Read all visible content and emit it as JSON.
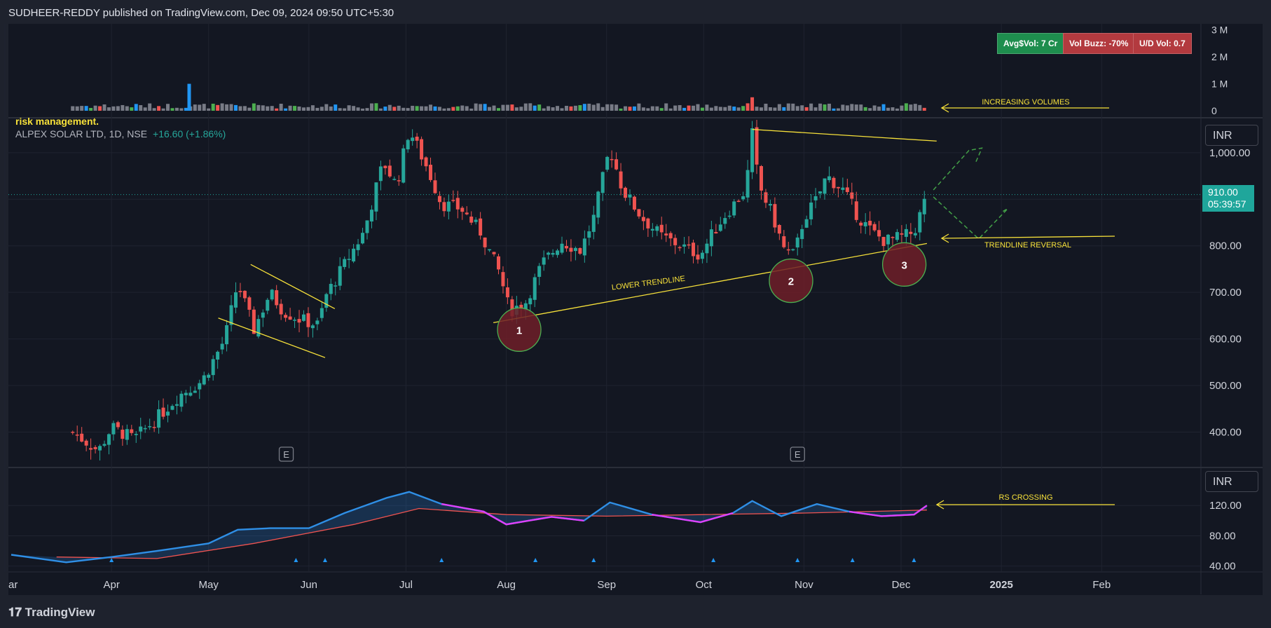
{
  "header": {
    "attribution": "SUDHEER-REDDY published on TradingView.com, Dec 09, 2024 09:50 UTC+5:30"
  },
  "footer": {
    "logo_text": "TradingView",
    "logo_icon": "tradingview-logo-icon"
  },
  "legend": {
    "note": "risk management.",
    "symbol": "ALPEX SOLAR LTD, 1D, NSE",
    "change": "+16.60 (+1.86%)"
  },
  "badges": [
    {
      "label": "Avg$Vol: 7 Cr",
      "color": "#1e8e4e"
    },
    {
      "label": "Vol Buzz: -70%",
      "color": "#b33a3f"
    },
    {
      "label": "U/D Vol: 0.7",
      "color": "#b33a3f"
    }
  ],
  "currency": {
    "main": "INR",
    "rs": "INR"
  },
  "last_price": {
    "value": "910.00",
    "countdown": "05:39:57"
  },
  "colors": {
    "up": "#26a69a",
    "down": "#ef5350",
    "annotation": "#f7e13a",
    "rs_line": "#2f8fe6",
    "rs_below": "#e040fb",
    "rs_ma": "#ef5350",
    "vol_blue": "#2196f3",
    "vol_green": "#4caf50",
    "vol_grey": "#787b86"
  },
  "chart_data": {
    "type": "candlestick",
    "symbol": "ALPEX SOLAR LTD",
    "interval": "1D",
    "exchange": "NSE",
    "x_ticks": [
      "ar",
      "Apr",
      "May",
      "Jun",
      "Jul",
      "Aug",
      "Sep",
      "Oct",
      "Nov",
      "Dec",
      "2025",
      "Feb"
    ],
    "price_axis": {
      "ylim": [
        330,
        1060
      ],
      "ticks": [
        "1,000.00",
        "900.00",
        "800.00",
        "700.00",
        "600.00",
        "500.00",
        "400.00"
      ],
      "scale": "linear"
    },
    "volume_axis": {
      "ylim": [
        0,
        3.2
      ],
      "unit": "M",
      "ticks": [
        "3 M",
        "2 M",
        "1 M",
        "0"
      ]
    },
    "rs_axis": {
      "ylim": [
        36,
        160
      ],
      "ticks": [
        "120.00",
        "80.00",
        "40.00"
      ]
    },
    "price_path": [
      [
        "2024-03-20",
        400
      ],
      [
        "2024-03-28",
        360
      ],
      [
        "2024-04-01",
        410
      ],
      [
        "2024-04-08",
        385
      ],
      [
        "2024-04-15",
        430
      ],
      [
        "2024-04-22",
        480
      ],
      [
        "2024-04-29",
        510
      ],
      [
        "2024-05-06",
        600
      ],
      [
        "2024-05-10",
        720
      ],
      [
        "2024-05-15",
        620
      ],
      [
        "2024-05-20",
        700
      ],
      [
        "2024-05-24",
        660
      ],
      [
        "2024-05-30",
        640
      ],
      [
        "2024-06-04",
        630
      ],
      [
        "2024-06-06",
        690
      ],
      [
        "2024-06-12",
        760
      ],
      [
        "2024-06-18",
        830
      ],
      [
        "2024-06-24",
        980
      ],
      [
        "2024-06-28",
        930
      ],
      [
        "2024-07-02",
        1050
      ],
      [
        "2024-07-08",
        960
      ],
      [
        "2024-07-12",
        890
      ],
      [
        "2024-07-18",
        880
      ],
      [
        "2024-07-24",
        830
      ],
      [
        "2024-07-30",
        740
      ],
      [
        "2024-08-02",
        660
      ],
      [
        "2024-08-07",
        680
      ],
      [
        "2024-08-12",
        760
      ],
      [
        "2024-08-18",
        810
      ],
      [
        "2024-08-24",
        790
      ],
      [
        "2024-08-28",
        860
      ],
      [
        "2024-09-02",
        1010
      ],
      [
        "2024-09-06",
        920
      ],
      [
        "2024-09-12",
        860
      ],
      [
        "2024-09-18",
        820
      ],
      [
        "2024-09-24",
        800
      ],
      [
        "2024-09-30",
        780
      ],
      [
        "2024-10-04",
        830
      ],
      [
        "2024-10-08",
        870
      ],
      [
        "2024-10-14",
        920
      ],
      [
        "2024-10-16",
        1040
      ],
      [
        "2024-10-18",
        930
      ],
      [
        "2024-10-22",
        870
      ],
      [
        "2024-10-26",
        790
      ],
      [
        "2024-10-29",
        780
      ],
      [
        "2024-11-01",
        860
      ],
      [
        "2024-11-05",
        900
      ],
      [
        "2024-11-08",
        950
      ],
      [
        "2024-11-13",
        920
      ],
      [
        "2024-11-18",
        860
      ],
      [
        "2024-11-22",
        830
      ],
      [
        "2024-11-26",
        810
      ],
      [
        "2024-12-02",
        820
      ],
      [
        "2024-12-05",
        830
      ],
      [
        "2024-12-09",
        910
      ]
    ],
    "volume_spikes_M": [
      {
        "date": "2024-04-25",
        "value": 1.0
      },
      {
        "date": "2024-10-16",
        "value": 0.5
      }
    ],
    "rs_series": {
      "name": "RS",
      "points": [
        [
          "2024-03-01",
          55
        ],
        [
          "2024-03-18",
          45
        ],
        [
          "2024-04-01",
          52
        ],
        [
          "2024-04-15",
          60
        ],
        [
          "2024-05-01",
          70
        ],
        [
          "2024-05-10",
          88
        ],
        [
          "2024-05-20",
          90
        ],
        [
          "2024-06-01",
          90
        ],
        [
          "2024-06-12",
          110
        ],
        [
          "2024-06-25",
          130
        ],
        [
          "2024-07-02",
          138
        ],
        [
          "2024-07-12",
          122
        ],
        [
          "2024-07-25",
          112
        ],
        [
          "2024-08-01",
          95
        ],
        [
          "2024-08-15",
          105
        ],
        [
          "2024-08-25",
          100
        ],
        [
          "2024-09-02",
          124
        ],
        [
          "2024-09-15",
          108
        ],
        [
          "2024-09-30",
          98
        ],
        [
          "2024-10-10",
          110
        ],
        [
          "2024-10-16",
          126
        ],
        [
          "2024-10-25",
          106
        ],
        [
          "2024-11-05",
          122
        ],
        [
          "2024-11-15",
          112
        ],
        [
          "2024-11-25",
          106
        ],
        [
          "2024-12-05",
          108
        ],
        [
          "2024-12-09",
          120
        ]
      ]
    },
    "rs_ma_series": {
      "name": "RS MA",
      "points": [
        [
          "2024-03-15",
          52
        ],
        [
          "2024-04-15",
          50
        ],
        [
          "2024-05-15",
          70
        ],
        [
          "2024-06-15",
          95
        ],
        [
          "2024-07-05",
          116
        ],
        [
          "2024-08-01",
          108
        ],
        [
          "2024-09-01",
          106
        ],
        [
          "2024-10-01",
          108
        ],
        [
          "2024-11-01",
          110
        ],
        [
          "2024-12-09",
          114
        ]
      ]
    },
    "earnings_markers": [
      {
        "date": "2024-05-25",
        "label": "E"
      },
      {
        "date": "2024-10-30",
        "label": "E"
      }
    ],
    "support_circles": [
      {
        "date": "2024-08-05",
        "price": 620,
        "label": "1"
      },
      {
        "date": "2024-10-28",
        "price": 725,
        "label": "2"
      },
      {
        "date": "2024-12-02",
        "price": 760,
        "label": "3"
      }
    ],
    "annotations": [
      {
        "text": "INCREASING VOLUMES"
      },
      {
        "text": "LOWER TRENDLINE"
      },
      {
        "text": "TRENDLINE REVERSAL"
      },
      {
        "text": "RS CROSSING"
      }
    ]
  }
}
